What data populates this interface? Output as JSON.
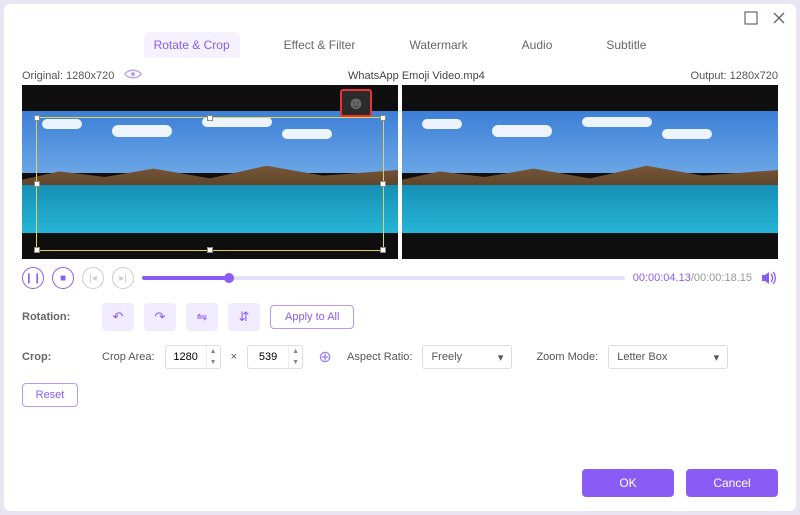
{
  "tabs": [
    "Rotate & Crop",
    "Effect & Filter",
    "Watermark",
    "Audio",
    "Subtitle"
  ],
  "active_tab": 0,
  "info": {
    "original": "Original: 1280x720",
    "filename": "WhatsApp Emoji Video.mp4",
    "output": "Output: 1280x720"
  },
  "player": {
    "current": "00:00:04.13",
    "total": "/00:00:18.15"
  },
  "rotation": {
    "label": "Rotation:",
    "apply": "Apply to All"
  },
  "crop": {
    "label": "Crop:",
    "area_label": "Crop Area:",
    "w": "1280",
    "h": "539",
    "sep": "×",
    "aspect_label": "Aspect Ratio:",
    "aspect_value": "Freely",
    "zoom_label": "Zoom Mode:",
    "zoom_value": "Letter Box",
    "reset": "Reset"
  },
  "footer": {
    "ok": "OK",
    "cancel": "Cancel"
  }
}
